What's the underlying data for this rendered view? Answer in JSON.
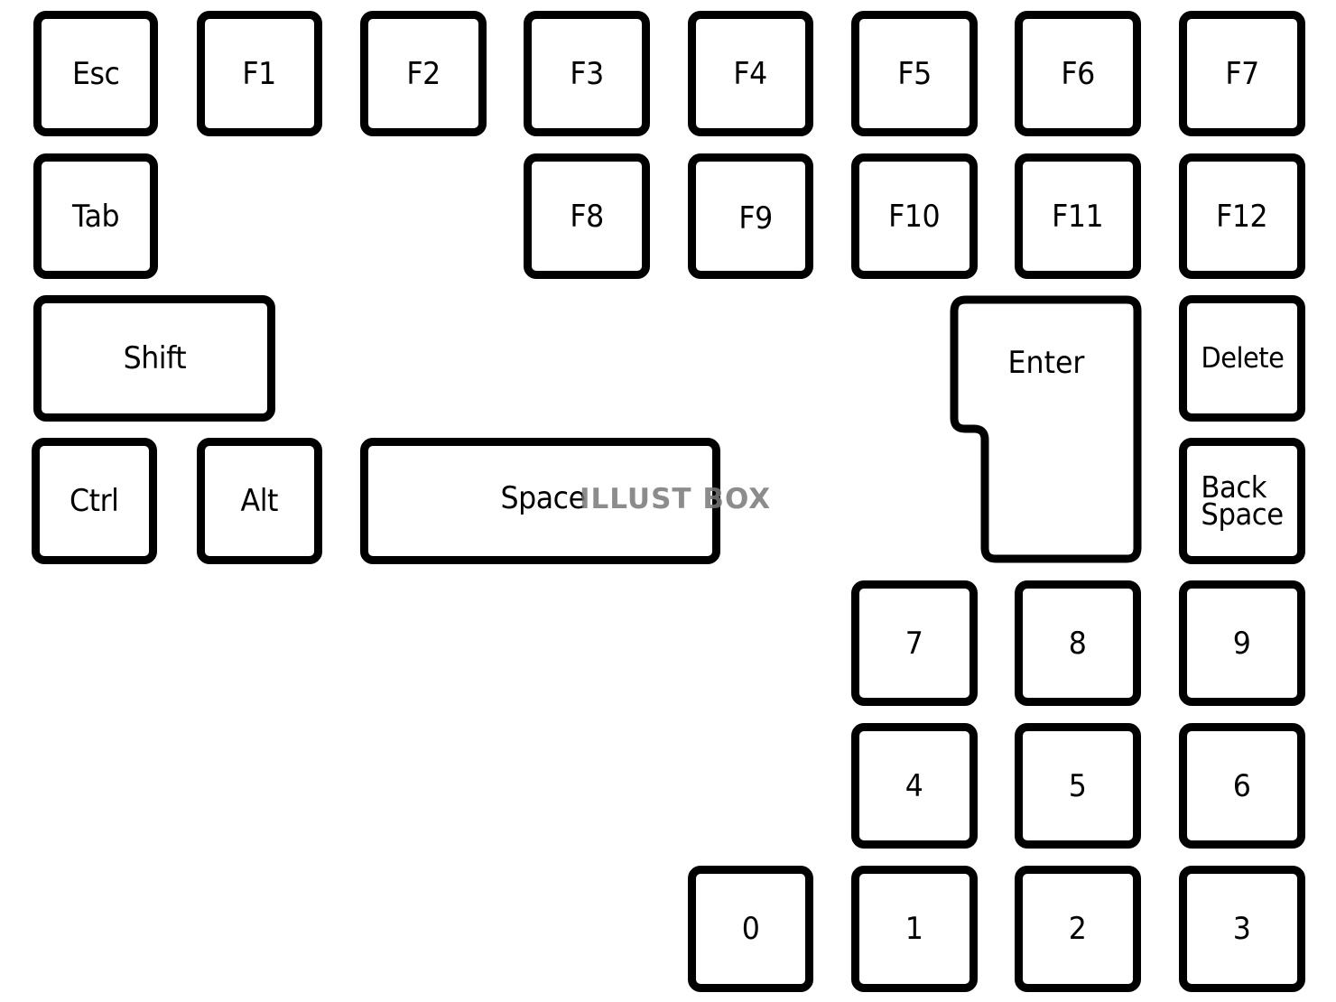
{
  "keyboard": {
    "function_row": {
      "esc": "Esc",
      "f1": "F1",
      "f2": "F2",
      "f3": "F3",
      "f4": "F4",
      "f5": "F5",
      "f6": "F6",
      "f7": "F7"
    },
    "second_row": {
      "tab": "Tab",
      "f8": "F8",
      "f9": "F9",
      "f10": "F10",
      "f11": "F11",
      "f12": "F12"
    },
    "modifiers": {
      "shift": "Shift",
      "ctrl": "Ctrl",
      "alt": "Alt",
      "space": "Space"
    },
    "editing": {
      "enter": "Enter",
      "delete": "Delete",
      "backspace_line1": "Back",
      "backspace_line2": "Space"
    },
    "numpad": {
      "n7": "7",
      "n8": "8",
      "n9": "9",
      "n4": "4",
      "n5": "5",
      "n6": "6",
      "n0": "0",
      "n1": "1",
      "n2": "2",
      "n3": "3"
    }
  },
  "watermark": "ILLUST BOX",
  "colors": {
    "key_border": "#000000",
    "key_face": "#ffffff",
    "watermark": "#787878"
  }
}
